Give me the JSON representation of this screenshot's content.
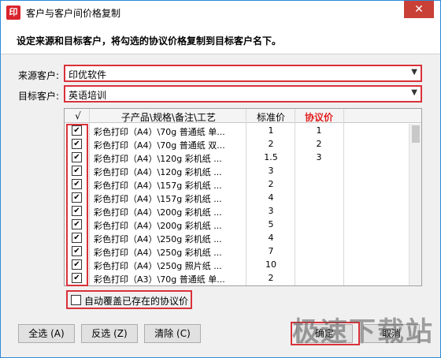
{
  "window": {
    "title": "客户与客户间价格复制",
    "close_label": "✕"
  },
  "header": {
    "text": "设定来源和目标客户，将勾选的协议价格复制到目标客户名下。"
  },
  "source": {
    "label": "来源客户:",
    "value": "印优软件"
  },
  "target": {
    "label": "目标客户:",
    "value": "英语培训"
  },
  "grid": {
    "headers": {
      "check": "√",
      "name": "子产品\\规格\\备注\\工艺",
      "std": "标准价",
      "deal": "协议价"
    },
    "rows": [
      {
        "name": "彩色打印（A4）\\70g 普通纸 单...",
        "std": "1",
        "deal": "1"
      },
      {
        "name": "彩色打印（A4）\\70g 普通纸 双...",
        "std": "2",
        "deal": "2"
      },
      {
        "name": "彩色打印（A4）\\120g 彩机纸 ...",
        "std": "1.5",
        "deal": "3"
      },
      {
        "name": "彩色打印（A4）\\120g 彩机纸 ...",
        "std": "3",
        "deal": ""
      },
      {
        "name": "彩色打印（A4）\\157g 彩机纸 ...",
        "std": "2",
        "deal": ""
      },
      {
        "name": "彩色打印（A4）\\157g 彩机纸 ...",
        "std": "4",
        "deal": ""
      },
      {
        "name": "彩色打印（A4）\\200g 彩机纸 ...",
        "std": "3",
        "deal": ""
      },
      {
        "name": "彩色打印（A4）\\200g 彩机纸 ...",
        "std": "5",
        "deal": ""
      },
      {
        "name": "彩色打印（A4）\\250g 彩机纸 ...",
        "std": "4",
        "deal": ""
      },
      {
        "name": "彩色打印（A4）\\250g 彩机纸 ...",
        "std": "7",
        "deal": ""
      },
      {
        "name": "彩色打印（A4）\\250g 照片纸 ...",
        "std": "10",
        "deal": ""
      },
      {
        "name": "彩色打印（A3）\\70g 普通纸 单...",
        "std": "2",
        "deal": ""
      }
    ]
  },
  "overwrite_label": "自动覆盖已存在的协议价",
  "buttons": {
    "select_all": "全选 (A)",
    "invert": "反选 (Z)",
    "clear": "清除 (C)",
    "ok": "确定",
    "cancel": "取消"
  },
  "watermark": "极速下载站",
  "colors": {
    "accent_red": "#d9323a",
    "header_red": "#e31d1d"
  }
}
